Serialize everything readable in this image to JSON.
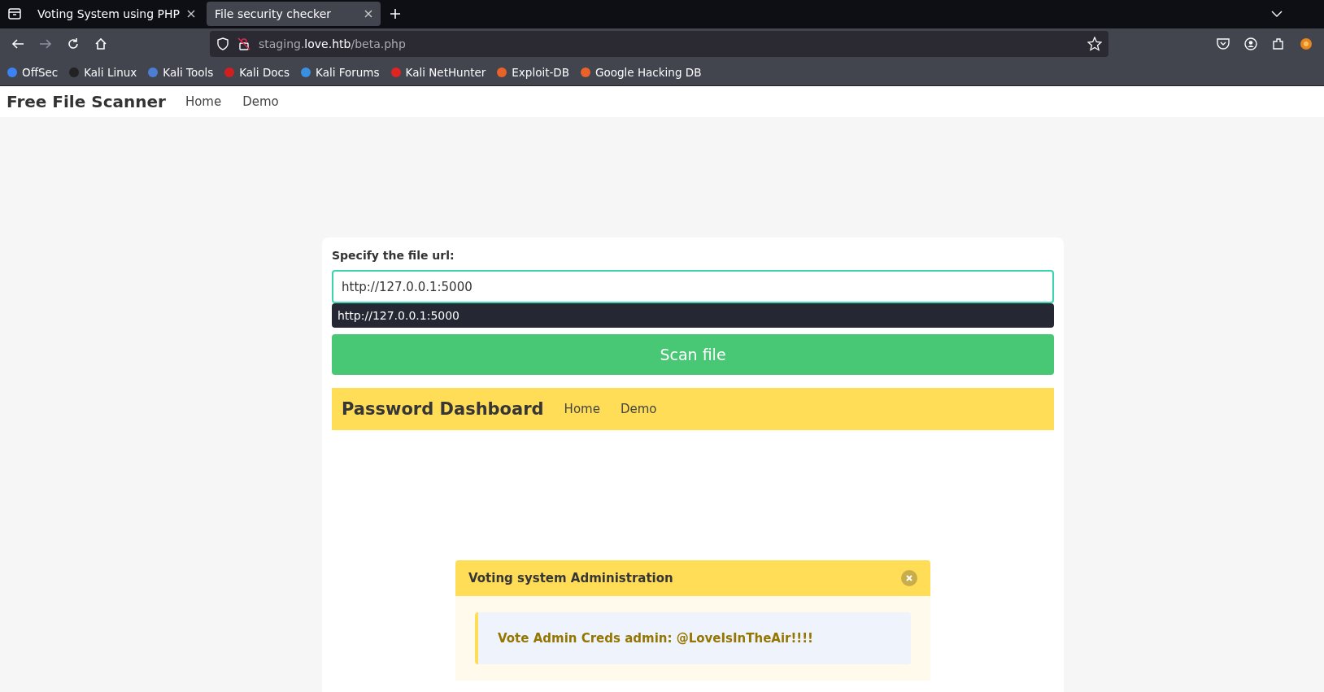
{
  "browser": {
    "tabs": [
      {
        "title": "Voting System using PHP",
        "selected": false
      },
      {
        "title": "File security checker",
        "selected": true
      }
    ],
    "address": {
      "subdomain": "staging.",
      "domain": "love.htb",
      "path": "/beta.php"
    },
    "bookmarks": [
      {
        "label": "OffSec",
        "color": "#3b82f6"
      },
      {
        "label": "Kali Linux",
        "color": "#222222"
      },
      {
        "label": "Kali Tools",
        "color": "#4a7fd4"
      },
      {
        "label": "Kali Docs",
        "color": "#d11f1f"
      },
      {
        "label": "Kali Forums",
        "color": "#3b8fe0"
      },
      {
        "label": "Kali NetHunter",
        "color": "#e02424"
      },
      {
        "label": "Exploit-DB",
        "color": "#e8622a"
      },
      {
        "label": "Google Hacking DB",
        "color": "#e8622a"
      }
    ]
  },
  "site": {
    "title": "Free File Scanner",
    "nav": [
      "Home",
      "Demo"
    ]
  },
  "form": {
    "label": "Specify the file url:",
    "value": "http://127.0.0.1:5000",
    "suggestions": [
      "http://127.0.0.1:5000"
    ],
    "button": "Scan file"
  },
  "result": {
    "title": "Password Dashboard",
    "nav": [
      "Home",
      "Demo"
    ],
    "notice": {
      "title": "Voting system Administration",
      "message": "Vote Admin Creds admin: @LoveIsInTheAir!!!!"
    }
  }
}
